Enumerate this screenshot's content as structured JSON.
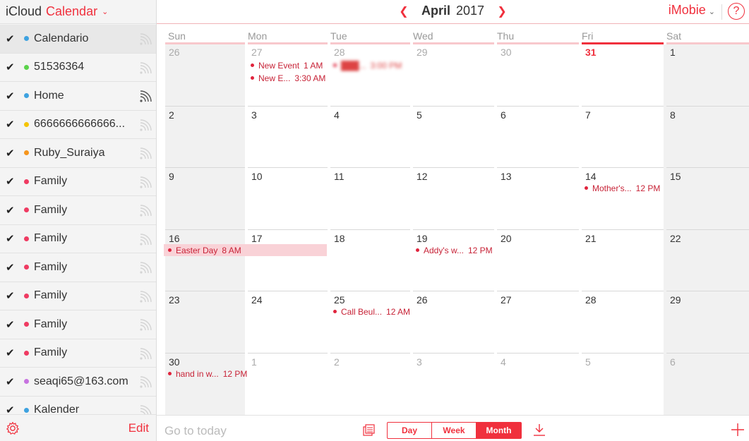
{
  "sidebar": {
    "brand": "iCloud",
    "app_name": "Calendar",
    "calendars": [
      {
        "name": "Calendario",
        "color": "#3ea2e0",
        "checked": true,
        "selected": true,
        "shared_dim": true
      },
      {
        "name": "51536364",
        "color": "#5bd34b",
        "checked": true,
        "shared_dim": true
      },
      {
        "name": "Home",
        "color": "#3ea2e0",
        "checked": true,
        "shared_dim": false
      },
      {
        "name": "6666666666666...",
        "color": "#f5c400",
        "checked": true,
        "shared_dim": true
      },
      {
        "name": "Ruby_Suraiya",
        "color": "#f5951d",
        "checked": true,
        "shared_dim": true
      },
      {
        "name": "Family",
        "color": "#ef3b62",
        "checked": true,
        "shared_dim": true
      },
      {
        "name": "Family",
        "color": "#ef3b62",
        "checked": true,
        "shared_dim": true
      },
      {
        "name": "Family",
        "color": "#ef3b62",
        "checked": true,
        "shared_dim": true
      },
      {
        "name": "Family",
        "color": "#ef3b62",
        "checked": true,
        "shared_dim": true
      },
      {
        "name": "Family",
        "color": "#ef3b62",
        "checked": true,
        "shared_dim": true
      },
      {
        "name": "Family",
        "color": "#ef3b62",
        "checked": true,
        "shared_dim": true
      },
      {
        "name": "Family",
        "color": "#ef3b62",
        "checked": true,
        "shared_dim": true
      },
      {
        "name": "seaqi65@163.com",
        "color": "#c773e0",
        "checked": true,
        "shared_dim": true
      },
      {
        "name": "Kalender",
        "color": "#3ea2e0",
        "checked": true,
        "shared_dim": true
      }
    ],
    "edit_label": "Edit"
  },
  "header": {
    "month": "April",
    "year": "2017",
    "user": "iMobie",
    "help": "?"
  },
  "weekdays": [
    "Sun",
    "Mon",
    "Tue",
    "Wed",
    "Thu",
    "Fri",
    "Sat"
  ],
  "today_column": 5,
  "weeks": [
    [
      {
        "d": "26",
        "other": true
      },
      {
        "d": "27",
        "other": true
      },
      {
        "d": "28",
        "other": true
      },
      {
        "d": "29",
        "other": true
      },
      {
        "d": "30",
        "other": true
      },
      {
        "d": "31",
        "today": true
      },
      {
        "d": "1"
      }
    ],
    [
      {
        "d": "2"
      },
      {
        "d": "3"
      },
      {
        "d": "4"
      },
      {
        "d": "5"
      },
      {
        "d": "6"
      },
      {
        "d": "7"
      },
      {
        "d": "8"
      }
    ],
    [
      {
        "d": "9"
      },
      {
        "d": "10"
      },
      {
        "d": "11"
      },
      {
        "d": "12"
      },
      {
        "d": "13"
      },
      {
        "d": "14"
      },
      {
        "d": "15"
      }
    ],
    [
      {
        "d": "16"
      },
      {
        "d": "17"
      },
      {
        "d": "18"
      },
      {
        "d": "19"
      },
      {
        "d": "20"
      },
      {
        "d": "21"
      },
      {
        "d": "22"
      }
    ],
    [
      {
        "d": "23"
      },
      {
        "d": "24"
      },
      {
        "d": "25"
      },
      {
        "d": "26"
      },
      {
        "d": "27"
      },
      {
        "d": "28"
      },
      {
        "d": "29"
      }
    ],
    [
      {
        "d": "30"
      },
      {
        "d": "1",
        "other": true
      },
      {
        "d": "2",
        "other": true
      },
      {
        "d": "3",
        "other": true
      },
      {
        "d": "4",
        "other": true
      },
      {
        "d": "5",
        "other": true
      },
      {
        "d": "6",
        "other": true
      }
    ]
  ],
  "events": [
    {
      "week": 0,
      "col": 1,
      "slot": 0,
      "title": "New Event",
      "time": "1 AM"
    },
    {
      "week": 0,
      "col": 1,
      "slot": 1,
      "title": "New E...",
      "time": "3:30 AM"
    },
    {
      "week": 0,
      "col": 2,
      "slot": 0,
      "title": "███...",
      "time": "3:00 PM",
      "blurred": true
    },
    {
      "week": 2,
      "col": 5,
      "slot": 0,
      "title": "Mother's...",
      "time": "12 PM"
    },
    {
      "week": 3,
      "col": 0,
      "slot": 0,
      "title": "Easter Day",
      "time": "8 AM",
      "span": 2
    },
    {
      "week": 3,
      "col": 3,
      "slot": 0,
      "title": "Addy's w...",
      "time": "12 PM"
    },
    {
      "week": 4,
      "col": 2,
      "slot": 0,
      "title": "Call Beul...",
      "time": "12 AM"
    },
    {
      "week": 5,
      "col": 0,
      "slot": 0,
      "title": "hand in w...",
      "time": "12 PM"
    }
  ],
  "footer": {
    "today_label": "Go to today",
    "views": [
      {
        "label": "Day",
        "active": false
      },
      {
        "label": "Week",
        "active": false
      },
      {
        "label": "Month",
        "active": true
      }
    ]
  },
  "colors": {
    "accent": "#f0303d",
    "event_text": "#c72236",
    "weekend_bg": "#f1f1f1"
  }
}
